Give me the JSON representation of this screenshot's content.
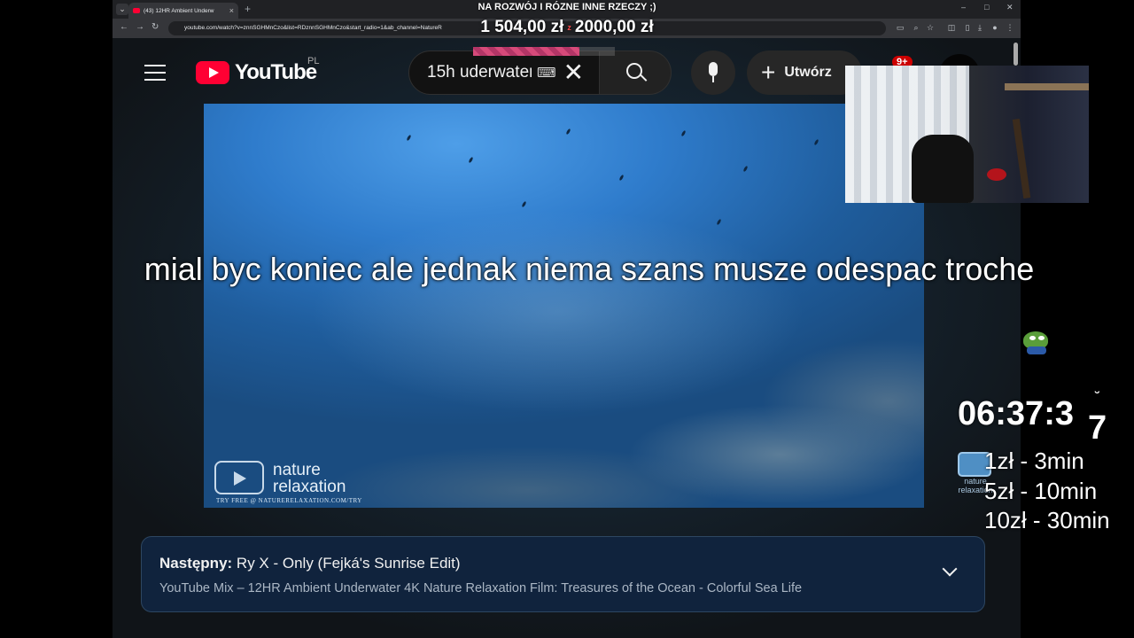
{
  "browser": {
    "tab_title": "(43) 12HR Ambient Underw",
    "address": "youtube.com/watch?v=znnSGHMnCzo&list=RDznnSGHMnCzo&start_radio=1&ab_channel=NatureR"
  },
  "youtube": {
    "logo_text": "YouTube",
    "country_code": "PL",
    "search_value": "15h uderwater",
    "create_label": "Utwórz",
    "notification_count": "9+",
    "next_prefix": "Następny:",
    "next_title": "Ry X - Only (Fejká's Sunrise Edit)",
    "next_subtitle": "YouTube Mix – 12HR Ambient Underwater 4K Nature Relaxation Film: Treasures of the Ocean - Colorful Sea Life"
  },
  "video": {
    "watermark_line1": "nature",
    "watermark_line2": "relaxation",
    "watermark_sub": "TRY FREE @ NATURERELAXATION.COM/TRY"
  },
  "overlay": {
    "stream_title": "NA ROZWÓJ I RÓZNE INNE RZECZY ;)",
    "goal_current": "1 504,00 zł",
    "goal_target": "2000,00 zł",
    "goal_separator": "z",
    "goal_progress": 0.752,
    "caption": "mial byc koniec ale jednak niema szans musze odespac troche",
    "timer": "06:37:3",
    "timer_last_digit": "7",
    "nr_logo_line1": "nature",
    "nr_logo_line2": "relaxation",
    "prices": [
      "1zł - 3min",
      "5zł - 10min",
      "10zł - 30min"
    ]
  }
}
